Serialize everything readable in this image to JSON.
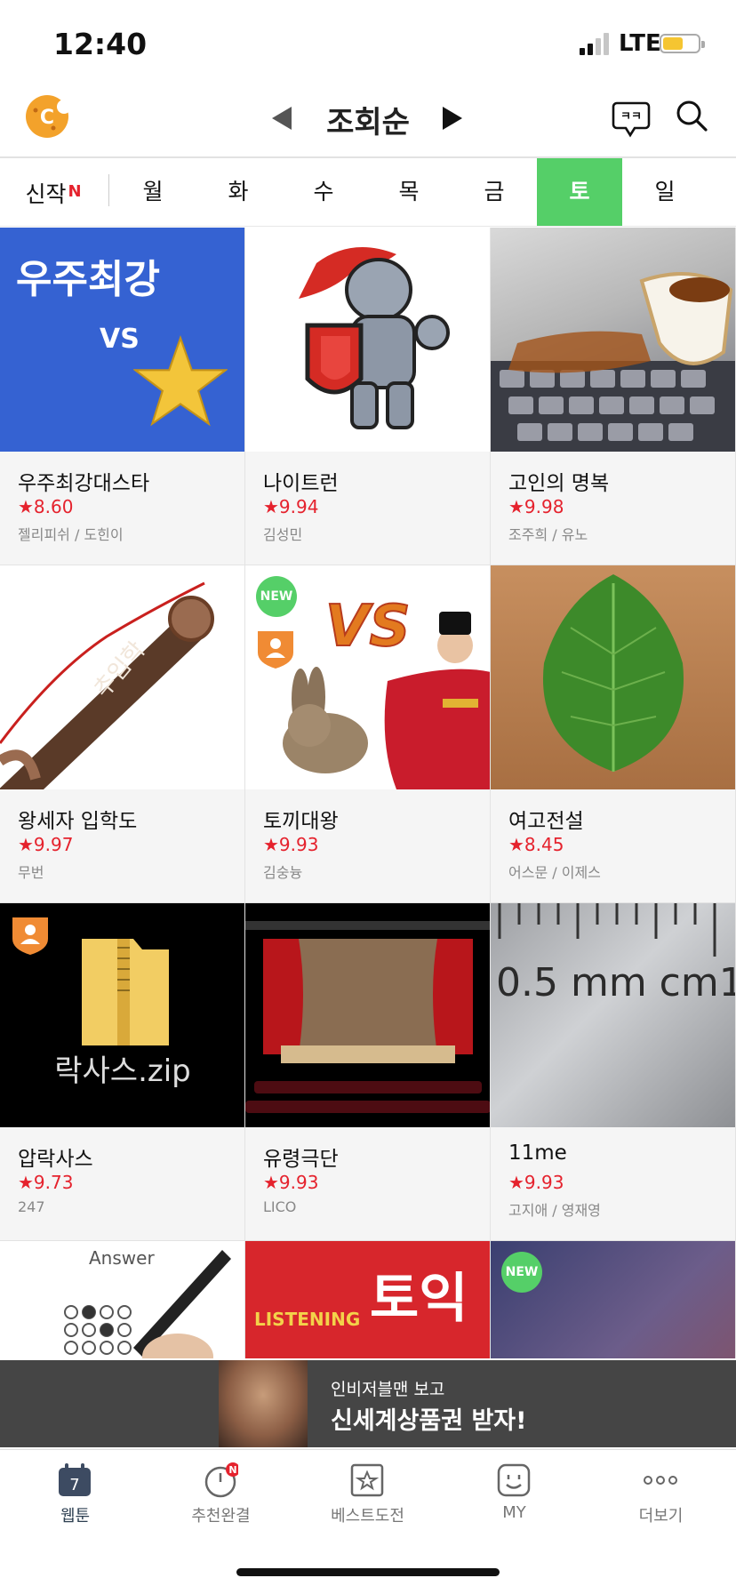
{
  "status_bar": {
    "time": "12:40",
    "network": "LTE",
    "battery_color": "#f5c531"
  },
  "header": {
    "logo_icon": "cookie-logo-icon",
    "sort_title": "조회순",
    "prev_icon": "caret-left-icon",
    "next_icon": "caret-right-icon",
    "chat_icon_text": "ㅋㅋ",
    "search_icon": "search-icon"
  },
  "tabs": {
    "new_label": "신작",
    "new_badge": "N",
    "days": [
      "월",
      "화",
      "수",
      "목",
      "금",
      "토",
      "일",
      "월"
    ],
    "active_index": 5,
    "active_color": "#55cf68"
  },
  "comics": [
    {
      "title": "우주최강대스타",
      "rating": "★8.60",
      "author": "젤리피쉬 / 도힌이",
      "thumb_text": "우주최강",
      "thumb_vs": "VS"
    },
    {
      "title": "나이트런",
      "rating": "★9.94",
      "author": "김성민"
    },
    {
      "title": "고인의 명복",
      "rating": "★9.98",
      "author": "조주희 / 유노"
    },
    {
      "title": "왕세자 입학도",
      "rating": "★9.97",
      "author": "무번",
      "thumb_text": "추입학"
    },
    {
      "title": "토끼대왕",
      "rating": "★9.93",
      "author": "김숭늉",
      "badge": "NEW",
      "thumb_vs": "VS"
    },
    {
      "title": "여고전설",
      "rating": "★8.45",
      "author": "어스문 / 이제스"
    },
    {
      "title": "압락사스",
      "rating": "★9.73",
      "author": "247",
      "thumb_text": "락사스.zip"
    },
    {
      "title": "유령극단",
      "rating": "★9.93",
      "author": "LICO"
    },
    {
      "title": "11me",
      "rating": "★9.93",
      "author": "고지애 / 영재영",
      "thumb_text": "0.5 mm cm1"
    },
    {
      "thumb_text": "Answer"
    },
    {
      "thumb_text": "토익",
      "thumb_sub": "LISTENING"
    },
    {
      "badge": "NEW"
    }
  ],
  "ad": {
    "line1": "인비저블맨 보고",
    "line2": "신세계상품권 받자!"
  },
  "bottom_nav": [
    {
      "label": "웹툰",
      "icon": "calendar-icon",
      "icon_text": "7"
    },
    {
      "label": "추천완결",
      "icon": "clock-icon",
      "badge": "N"
    },
    {
      "label": "베스트도전",
      "icon": "star-bookmark-icon"
    },
    {
      "label": "MY",
      "icon": "smiley-icon"
    },
    {
      "label": "더보기",
      "icon": "more-dots-icon"
    }
  ]
}
